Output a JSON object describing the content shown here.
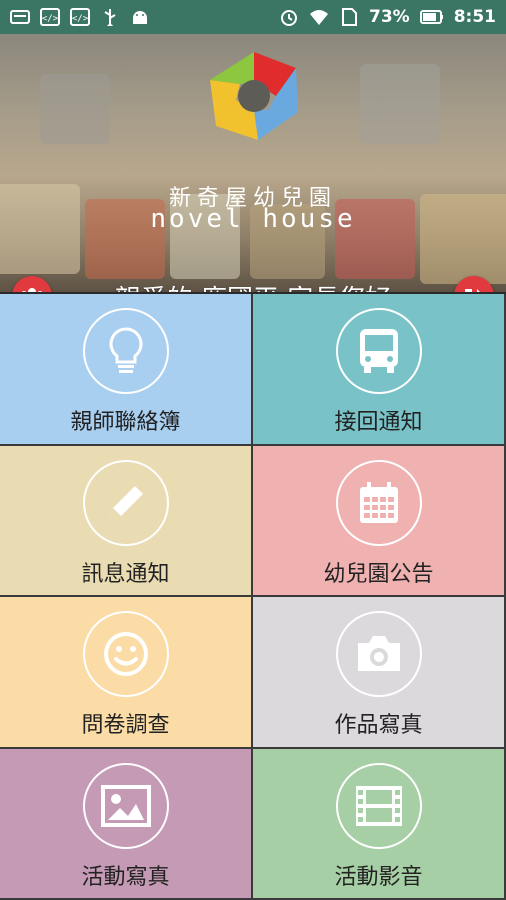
{
  "status_bar": {
    "battery_percent": "73%",
    "time": "8:51",
    "icons": [
      "keyboard-icon",
      "code-icon",
      "code-icon",
      "usb-icon",
      "android-icon",
      "alarm-icon",
      "wifi-icon",
      "sim-icon",
      "battery-icon"
    ]
  },
  "header": {
    "brand_cn": "新奇屋幼兒園",
    "brand_en": "novel house",
    "greeting": "親愛的 龐國平 家長您好",
    "logo_colors": [
      "#e02c2c",
      "#6aa9e0",
      "#f2c12e",
      "#8dc63f"
    ]
  },
  "menu": {
    "tiles": [
      {
        "label": "親師聯絡簿",
        "icon": "lightbulb-icon",
        "color": "#a9cff0"
      },
      {
        "label": "接回通知",
        "icon": "bus-icon",
        "color": "#79c3c8"
      },
      {
        "label": "訊息通知",
        "icon": "pencil-icon",
        "color": "#e9dcb3"
      },
      {
        "label": "幼兒園公告",
        "icon": "calendar-icon",
        "color": "#f0b1b1"
      },
      {
        "label": "問卷調查",
        "icon": "smiley-icon",
        "color": "#fbdca6"
      },
      {
        "label": "作品寫真",
        "icon": "camera-icon",
        "color": "#dcd9dc"
      },
      {
        "label": "活動寫真",
        "icon": "picture-icon",
        "color": "#c59ab5"
      },
      {
        "label": "活動影音",
        "icon": "film-icon",
        "color": "#a6cfa5"
      }
    ]
  }
}
